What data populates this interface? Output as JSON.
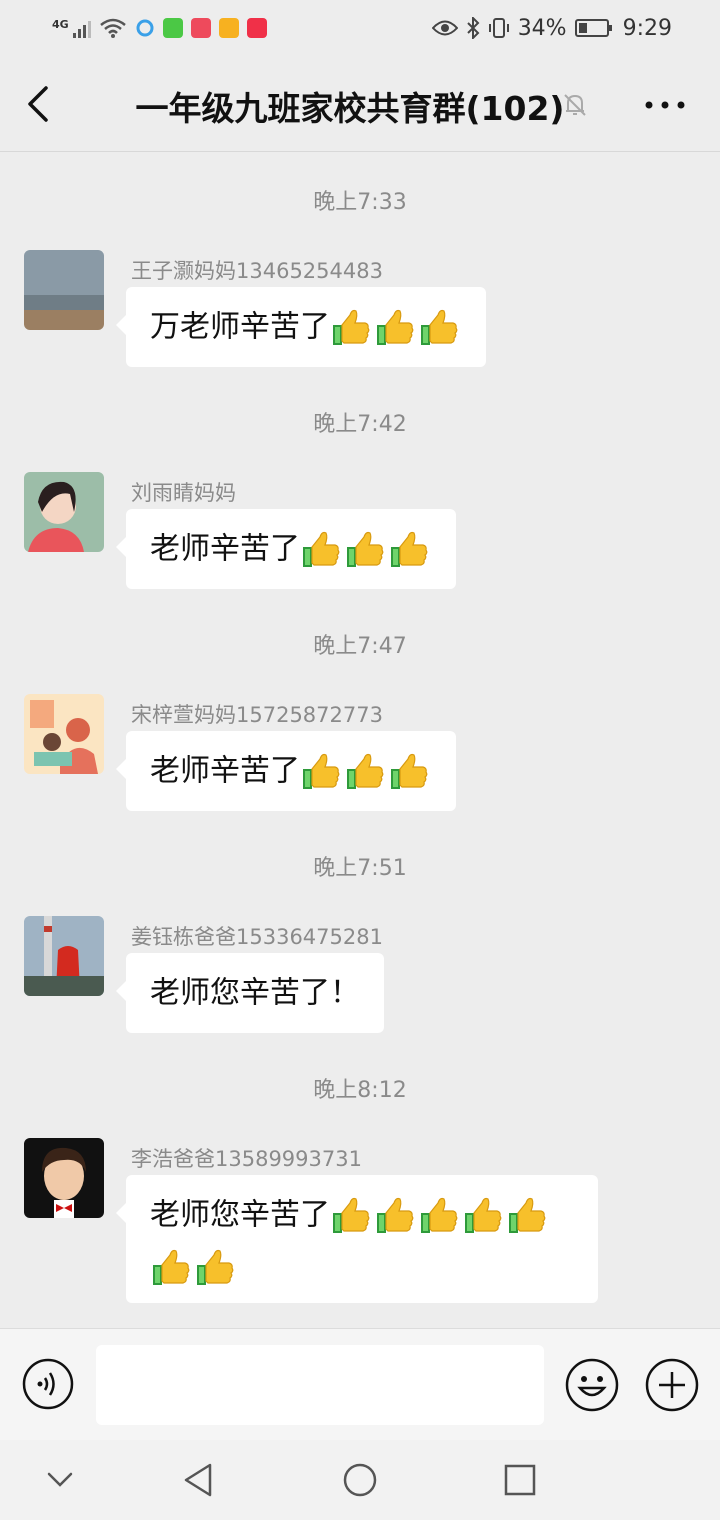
{
  "status_bar": {
    "network": "4G",
    "battery": "34%",
    "battery_level": 0.34,
    "time": "9:29"
  },
  "header": {
    "title": "一年级九班家校共育群(102)"
  },
  "messages": [
    {
      "time": "晚上7:33",
      "sender": "王子灏妈妈13465254483",
      "text": "万老师辛苦了",
      "thumbs": 3
    },
    {
      "time": "晚上7:42",
      "sender": "刘雨睛妈妈",
      "text": "老师辛苦了",
      "thumbs": 3
    },
    {
      "time": "晚上7:47",
      "sender": "宋梓萱妈妈15725872773",
      "text": "老师辛苦了",
      "thumbs": 3
    },
    {
      "time": "晚上7:51",
      "sender": "姜钰栋爸爸15336475281",
      "text": "老师您辛苦了！",
      "thumbs": 0
    },
    {
      "time": "晚上8:12",
      "sender": "李浩爸爸13589993731",
      "text": "老师您辛苦了",
      "thumbs": 7
    }
  ],
  "input": {
    "value": ""
  },
  "colors": {
    "bg": "#ededed",
    "bubble": "#ffffff",
    "muted_text": "#8a8a8a"
  }
}
